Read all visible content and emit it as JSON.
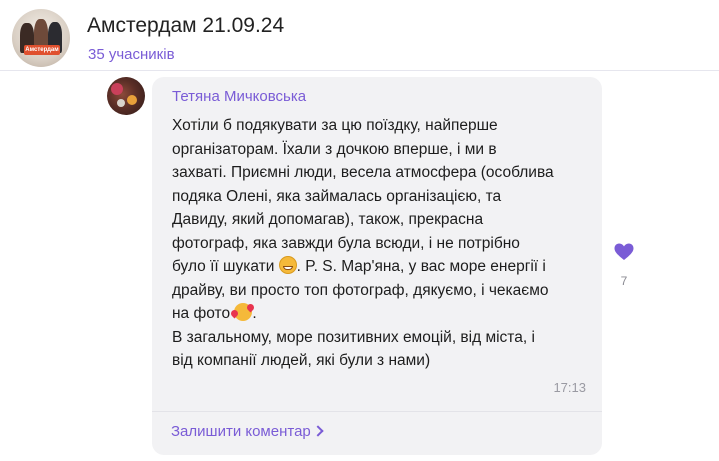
{
  "header": {
    "title": "Амстердам 21.09.24",
    "members": "35 учасників",
    "avatar_badge": "Амстердам"
  },
  "message": {
    "author": "Тетяна Мичковська",
    "text_part1": "Хотіли б подякувати за цю поїздку, найперше\nорганізаторам. Їхали з дочкою вперше, і ми в\nзахваті. Приємні люди, весела атмосфера (особлива\nподяка Олені, яка займалась організацією, та\nДавиду, який допомагав), також, прекрасна\nфотограф, яка завжди була всюди, і не потрібно\nбуло її шукати ",
    "text_part2": ". P. S. Мар'яна, у вас море енергії і\nдрайву, ви просто топ фотограф, дякуємо, і чекаємо\nна фото ",
    "text_part3": ".\nВ загальному, море позитивних емоцій, від міста, і\nвід компанії людей, які були з нами)",
    "emoji_1": "grinning-face-emoji",
    "emoji_2": "smiling-face-with-hearts-emoji",
    "time": "17:13"
  },
  "reaction": {
    "icon": "heart-icon",
    "count": "7",
    "color": "#7a5cd6"
  },
  "footer": {
    "leave_comment": "Залишити коментар"
  },
  "colors": {
    "accent": "#7a5cd6",
    "bubble": "#f2f2f4"
  }
}
